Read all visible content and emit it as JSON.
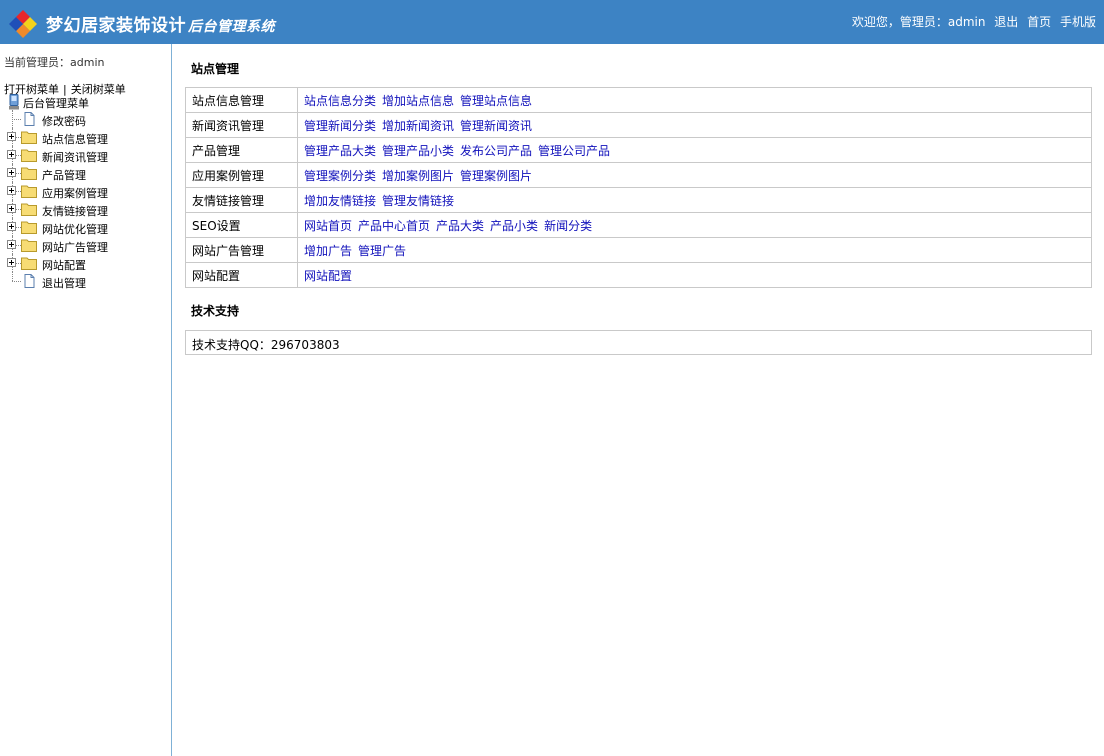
{
  "header": {
    "title": "梦幻居家装饰设计",
    "subtitle": "后台管理系统",
    "welcome": "欢迎您，管理员：admin",
    "logout": "退出",
    "home": "首页",
    "mobile": "手机版"
  },
  "sidebar": {
    "current_admin": "当前管理员：admin",
    "open_tree": "打开树菜单",
    "separator": "|",
    "close_tree": "关闭树菜单",
    "root": "后台管理菜单",
    "items": [
      {
        "label": "修改密码",
        "icon": "page-icon"
      },
      {
        "label": "站点信息管理",
        "icon": "folder-icon"
      },
      {
        "label": "新闻资讯管理",
        "icon": "folder-icon"
      },
      {
        "label": "产品管理",
        "icon": "folder-icon"
      },
      {
        "label": "应用案例管理",
        "icon": "folder-icon"
      },
      {
        "label": "友情链接管理",
        "icon": "folder-icon"
      },
      {
        "label": "网站优化管理",
        "icon": "folder-icon"
      },
      {
        "label": "网站广告管理",
        "icon": "folder-icon"
      },
      {
        "label": "网站配置",
        "icon": "folder-icon"
      },
      {
        "label": "退出管理",
        "icon": "page-icon"
      }
    ]
  },
  "main": {
    "section_title": "站点管理",
    "rows": [
      {
        "category": "站点信息管理",
        "links": [
          "站点信息分类",
          "增加站点信息",
          "管理站点信息"
        ]
      },
      {
        "category": "新闻资讯管理",
        "links": [
          "管理新闻分类",
          "增加新闻资讯",
          "管理新闻资讯"
        ]
      },
      {
        "category": "产品管理",
        "links": [
          "管理产品大类",
          "管理产品小类",
          "发布公司产品",
          "管理公司产品"
        ]
      },
      {
        "category": "应用案例管理",
        "links": [
          "管理案例分类",
          "增加案例图片",
          "管理案例图片"
        ]
      },
      {
        "category": "友情链接管理",
        "links": [
          "增加友情链接",
          "管理友情链接"
        ]
      },
      {
        "category": "SEO设置",
        "links": [
          "网站首页",
          "产品中心首页",
          "产品大类",
          "产品小类",
          "新闻分类"
        ]
      },
      {
        "category": "网站广告管理",
        "links": [
          "增加广告",
          "管理广告"
        ]
      },
      {
        "category": "网站配置",
        "links": [
          "网站配置"
        ]
      }
    ],
    "support_title": "技术支持",
    "support_text": "技术支持QQ：296703803"
  },
  "colors": {
    "header_bg": "#3d83c4",
    "link": "#1111bb",
    "border": "#c9c9c9",
    "sidebar_border": "#7fb1d6"
  }
}
